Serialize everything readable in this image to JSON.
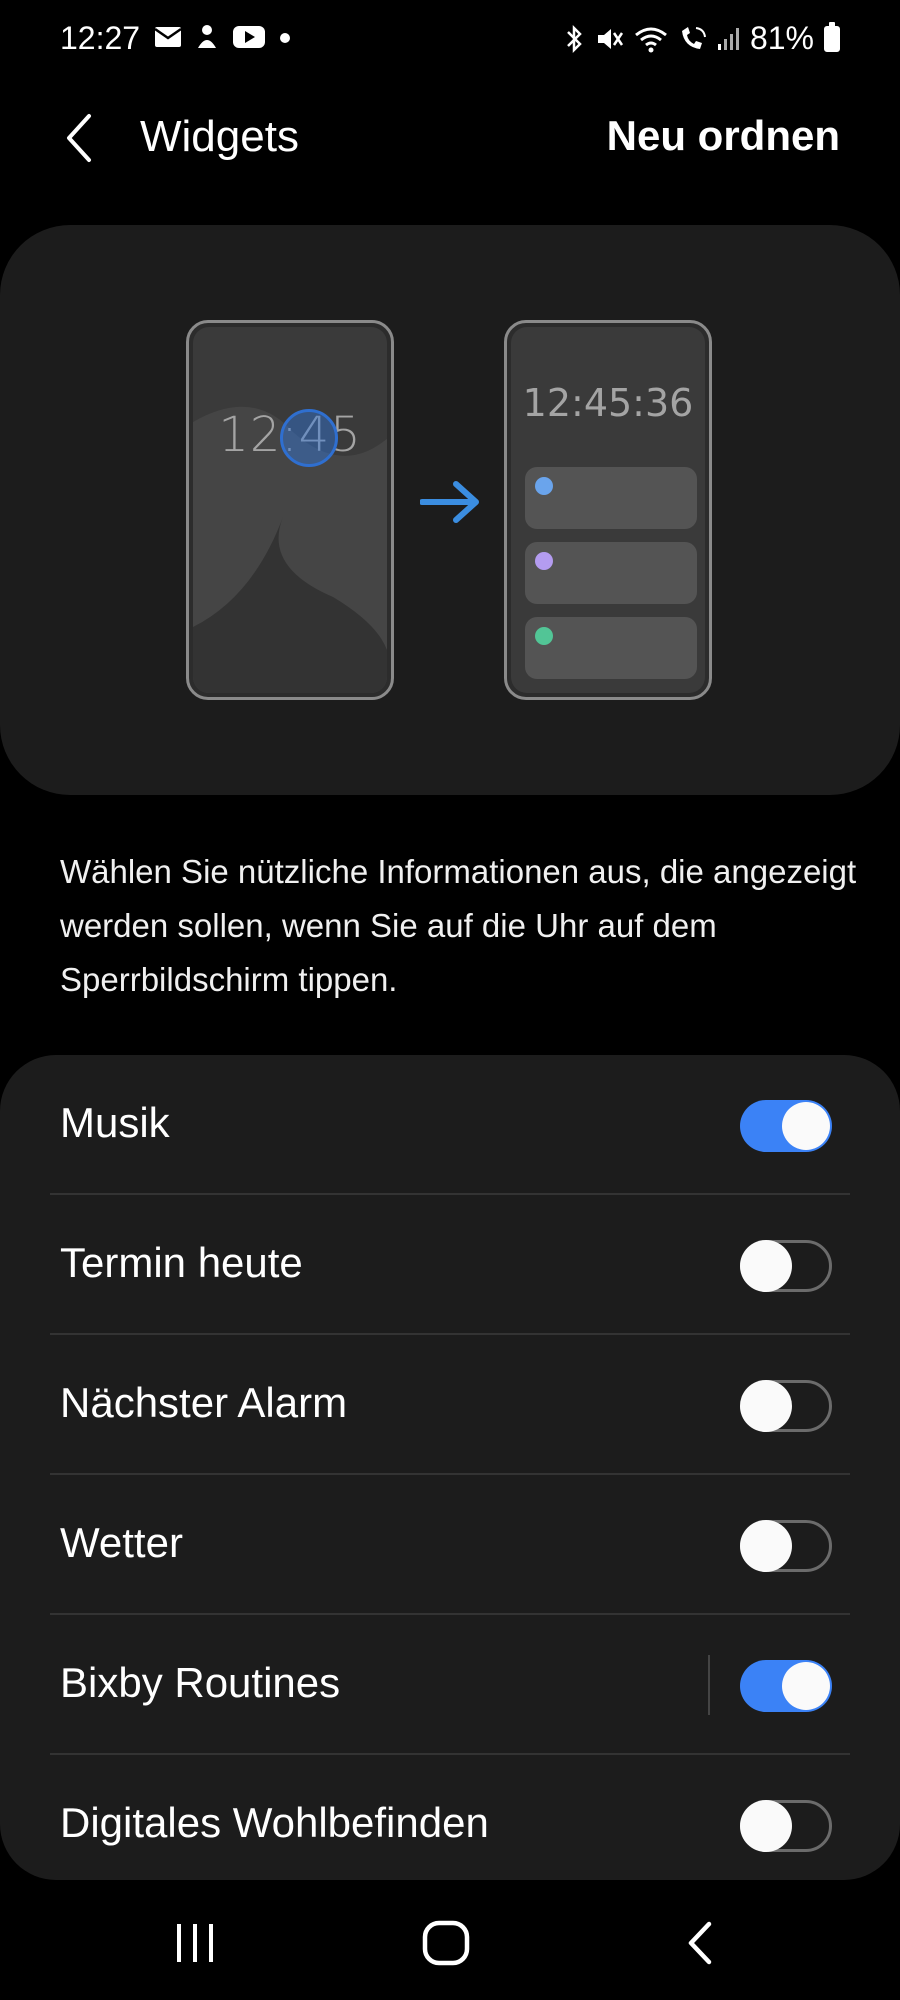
{
  "status_bar": {
    "time": "12:27",
    "battery": "81%",
    "left_icons": [
      "email-icon",
      "notification-icon",
      "youtube-icon",
      "dot-icon"
    ],
    "right_icons": [
      "bluetooth-icon",
      "mute-icon",
      "wifi-icon",
      "wifi-call-icon",
      "signal-icon",
      "battery-icon"
    ]
  },
  "header": {
    "title": "Widgets",
    "reorder_label": "Neu ordnen"
  },
  "illustration": {
    "left_clock": "12:45",
    "right_clock": "12:45:36",
    "widget_colors": [
      "#6aa4ec",
      "#b49cf0",
      "#52c596"
    ],
    "accent": "#3b8de0"
  },
  "description": "Wählen Sie nützliche Informationen aus, die angezeigt werden sollen, wenn Sie auf die Uhr auf dem Sperrbildschirm tippen.",
  "settings": [
    {
      "label": "Musik",
      "enabled": true
    },
    {
      "label": "Termin heute",
      "enabled": false
    },
    {
      "label": "Nächster Alarm",
      "enabled": false
    },
    {
      "label": "Wetter",
      "enabled": false
    },
    {
      "label": "Bixby Routines",
      "enabled": true
    },
    {
      "label": "Digitales Wohlbefinden",
      "enabled": false
    }
  ],
  "nav": [
    "recents-icon",
    "home-icon",
    "back-icon"
  ],
  "colors": {
    "toggle_on": "#3b82f6",
    "card_bg": "#1c1c1c"
  }
}
